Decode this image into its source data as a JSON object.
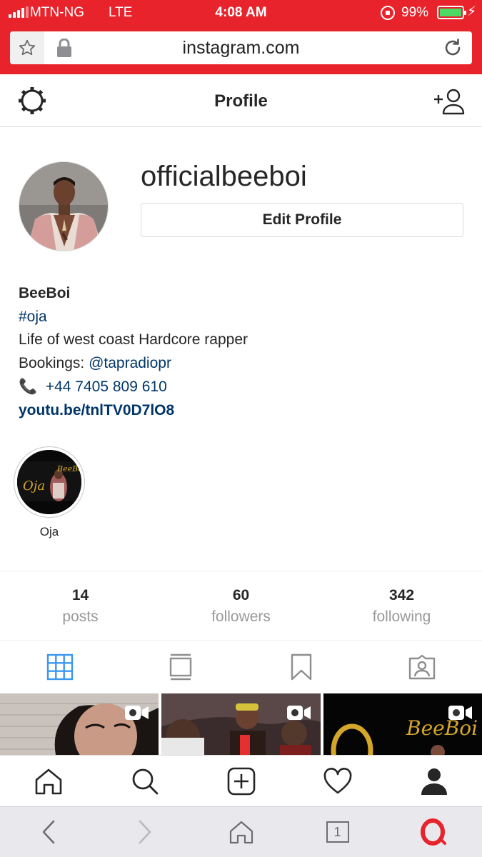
{
  "status_bar": {
    "carrier": "MTN-NG",
    "network": "LTE",
    "time": "4:08 AM",
    "battery_percent": "99%",
    "battery_level": 0.99
  },
  "browser": {
    "url": "instagram.com"
  },
  "header": {
    "title": "Profile"
  },
  "profile": {
    "username": "officialbeeboi",
    "edit_label": "Edit Profile",
    "name": "BeeBoi",
    "hashtag": "#oja",
    "bio_line": "Life of west coast Hardcore rapper",
    "bookings_prefix": "Bookings: ",
    "bookings_handle": "@tapradiopr",
    "phone_icon": "📞",
    "phone": "+44 7405 809 610",
    "website": "youtu.be/tnlTV0D7lO8"
  },
  "highlights": [
    {
      "label": "Oja",
      "art_title": "BeeBoi",
      "art_mark": "Oja"
    }
  ],
  "stats": [
    {
      "value": "14",
      "label": "posts"
    },
    {
      "value": "60",
      "label": "followers"
    },
    {
      "value": "342",
      "label": "following"
    }
  ],
  "grid_posts": [
    {
      "art_title": "BeeBoi"
    }
  ],
  "colors": {
    "brand_red": "#e8232b",
    "link": "#003569",
    "active_tab": "#3897f0",
    "muted": "#999999"
  },
  "icons": [
    "gear-icon",
    "add-user-icon",
    "grid-icon",
    "feed-icon",
    "bookmark-icon",
    "tagged-icon",
    "home-icon",
    "search-icon",
    "new-post-icon",
    "heart-icon",
    "profile-icon"
  ]
}
